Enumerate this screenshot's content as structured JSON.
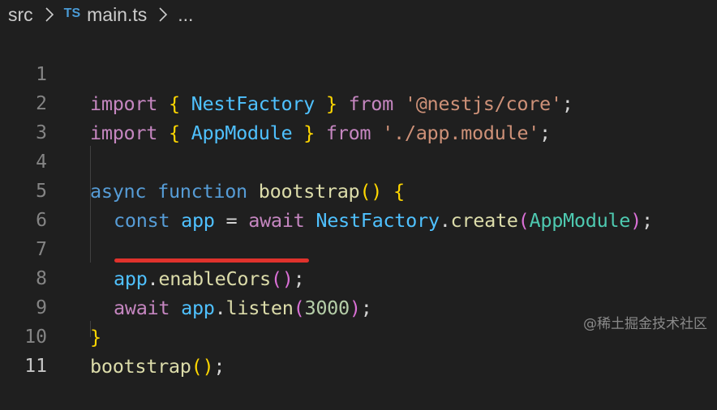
{
  "breadcrumb": {
    "folder": "src",
    "file_icon": "TS",
    "file_name": "main.ts",
    "ellipsis": "..."
  },
  "editor": {
    "line_numbers": [
      "1",
      "2",
      "3",
      "4",
      "5",
      "6",
      "7",
      "8",
      "9",
      "10",
      "11"
    ],
    "lines": {
      "l1": {
        "a": "import",
        "b": "{",
        "c": "NestFactory",
        "d": "}",
        "e": "from",
        "f": "'@nestjs/core'",
        "g": ";"
      },
      "l2": {
        "a": "import",
        "b": "{",
        "c": "AppModule",
        "d": "}",
        "e": "from",
        "f": "'./app.module'",
        "g": ";"
      },
      "l4": {
        "a": "async",
        "b": "function",
        "c": "bootstrap",
        "d": "()",
        "e": "{"
      },
      "l5": {
        "a": "const",
        "b": "app",
        "c": "=",
        "d": "await",
        "e": "NestFactory",
        "f": ".",
        "g": "create",
        "h": "(",
        "i": "AppModule",
        "j": ")",
        "k": ";"
      },
      "l7": {
        "a": "app",
        "b": ".",
        "c": "enableCors",
        "d": "()",
        "e": ";"
      },
      "l8": {
        "a": "await",
        "b": "app",
        "c": ".",
        "d": "listen",
        "e": "(",
        "f": "3000",
        "g": ")",
        "h": ";"
      },
      "l9": {
        "a": "}"
      },
      "l10": {
        "a": "bootstrap",
        "b": "()",
        "c": ";"
      }
    }
  },
  "watermark": "@稀土掘金技术社区",
  "colors": {
    "background": "#1f1f1f",
    "annotation_underline": "#e0322c"
  }
}
